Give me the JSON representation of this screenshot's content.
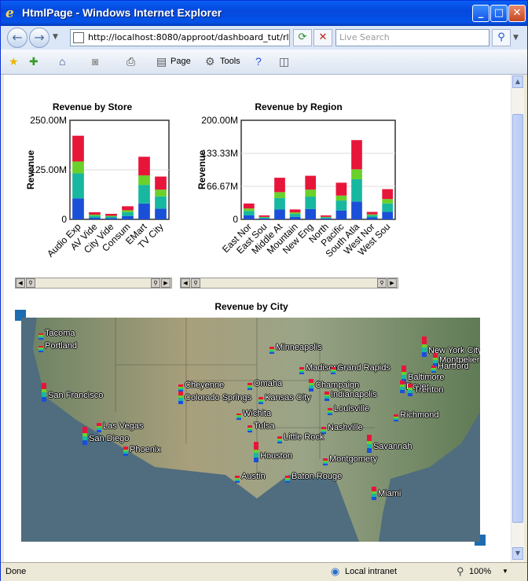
{
  "window": {
    "title": "HtmlPage - Windows Internet Explorer"
  },
  "nav": {
    "url": "http://localhost:8080/approot/dashboard_tut/rlte",
    "search_placeholder": "Live Search"
  },
  "cmd": {
    "page": "Page",
    "tools": "Tools"
  },
  "status": {
    "left": "Done",
    "zone": "Local intranet",
    "zoom": "100%"
  },
  "colors": {
    "blue": "#1a4fd8",
    "teal": "#18b8a0",
    "green": "#6ad02a",
    "red": "#e8153a",
    "navy": "#143c8c"
  },
  "chart_data": [
    {
      "type": "bar",
      "title": "Revenue by Store",
      "ylabel": "Revenue",
      "ylim": [
        0,
        250000000
      ],
      "ytick_labels": [
        "250.00M",
        "125.00M",
        "0"
      ],
      "categories": [
        "Audio Exp",
        "AV Vide",
        "City Vide",
        "Consum",
        "EMart",
        "TV City"
      ],
      "stack_colors": [
        "#1a4fd8",
        "#18b8a0",
        "#6ad02a",
        "#e8153a"
      ],
      "stacks": [
        [
          53,
          63,
          30,
          65
        ],
        [
          4,
          5,
          3,
          6
        ],
        [
          3,
          4,
          2,
          5
        ],
        [
          8,
          10,
          5,
          10
        ],
        [
          40,
          47,
          24,
          47
        ],
        [
          27,
          31,
          17,
          33
        ]
      ]
    },
    {
      "type": "bar",
      "title": "Revenue by Region",
      "ylabel": "Revenue",
      "ylim": [
        0,
        200000000
      ],
      "ytick_labels": [
        "200.00M",
        "133.33M",
        "66.67M",
        "0"
      ],
      "categories": [
        "East Nor",
        "East Sou",
        "Middle At",
        "Mountain",
        "New Eng",
        "North",
        "Pacific",
        "South Atla",
        "West Nor",
        "West Sou"
      ],
      "stack_colors": [
        "#1a4fd8",
        "#18b8a0",
        "#6ad02a",
        "#e8153a"
      ],
      "stacks": [
        [
          8,
          9,
          5,
          10
        ],
        [
          2,
          2,
          1,
          3
        ],
        [
          20,
          23,
          12,
          29
        ],
        [
          5,
          6,
          3,
          6
        ],
        [
          21,
          25,
          14,
          28
        ],
        [
          2,
          2,
          1,
          3
        ],
        [
          18,
          20,
          10,
          26
        ],
        [
          36,
          45,
          20,
          59
        ],
        [
          4,
          4,
          2,
          5
        ],
        [
          15,
          17,
          9,
          20
        ]
      ]
    },
    {
      "type": "bar",
      "title": "Revenue by City",
      "cities": [
        "Tacoma",
        "Portland",
        "San Francisco",
        "Las Vegas",
        "San Diego",
        "Phoenix",
        "Cheyenne",
        "Colorado Springs",
        "Omaha",
        "Kansas City",
        "Wichita",
        "Tulsa",
        "Minneapolis",
        "Madison",
        "Grand Rapids",
        "Champaign",
        "Indianapolis",
        "Louisville",
        "Nashville",
        "Little Rock",
        "Houston",
        "Austin",
        "Baton Rouge",
        "Montgomery",
        "Savannah",
        "Miami",
        "Richmond",
        "Baltimore",
        "Dover",
        "Trenton",
        "New York City",
        "Montpelier",
        "Hartford"
      ]
    }
  ]
}
